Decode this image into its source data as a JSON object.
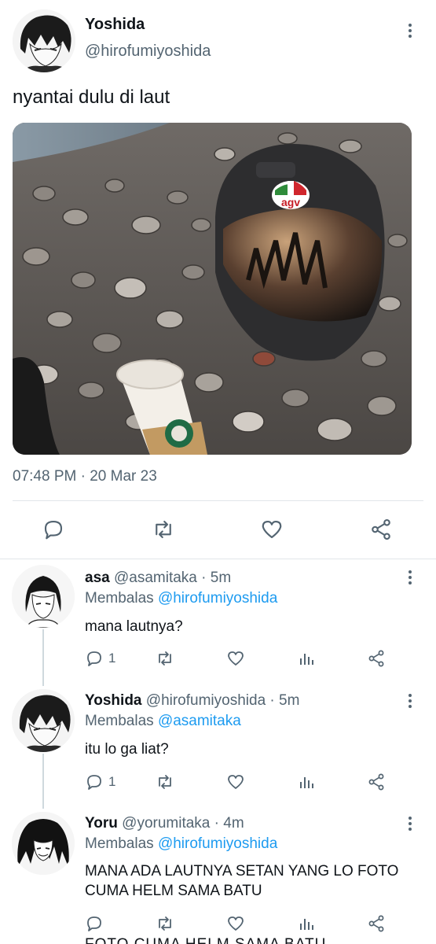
{
  "main_tweet": {
    "name": "Yoshida",
    "handle": "@hirofumiyoshida",
    "text": "nyantai dulu di laut",
    "timestamp": "07:48 PM · 20 Mar 23",
    "photo_icon": "helmet-photo"
  },
  "actions": {
    "reply_icon": "reply-icon",
    "retweet_icon": "retweet-icon",
    "like_icon": "like-icon",
    "share_icon": "share-icon",
    "views_icon": "views-icon"
  },
  "replies": [
    {
      "name": "asa",
      "handle": "@asamitaka · 5m",
      "replying_prefix": "Membalas",
      "replying_to": "@hirofumiyoshida",
      "text": "mana lautnya?",
      "reply_count": "1"
    },
    {
      "name": "Yoshida",
      "handle": "@hirofumiyoshida · 5m",
      "replying_prefix": "Membalas",
      "replying_to": "@asamitaka",
      "text": "itu lo ga liat?",
      "reply_count": "1"
    },
    {
      "name": "Yoru",
      "handle": "@yorumitaka · 4m",
      "replying_prefix": "Membalas",
      "replying_to": "@hirofumiyoshida",
      "text": "MANA ADA LAUTNYA SETAN YANG LO FOTO CUMA HELM SAMA BATU",
      "reply_count": ""
    }
  ],
  "cut_off_text": "FOTO CUMA HELM SAMA BATU",
  "colors": {
    "link": "#1d9bf0",
    "secondary": "#536471",
    "primary": "#0f1419",
    "divider": "#e1e6ea"
  }
}
